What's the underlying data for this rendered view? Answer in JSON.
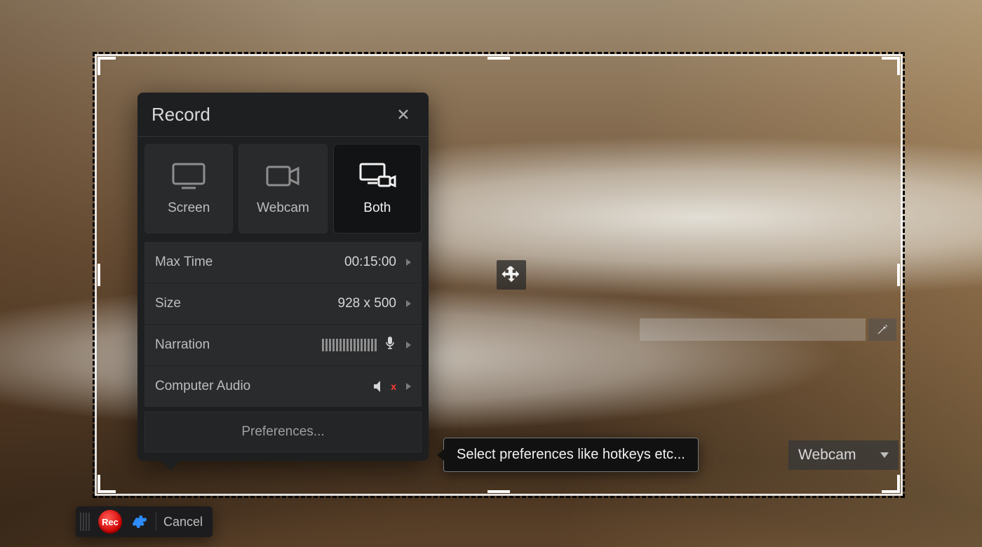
{
  "panel": {
    "title": "Record",
    "modes": {
      "screen": "Screen",
      "webcam": "Webcam",
      "both": "Both"
    },
    "rows": {
      "maxtime_label": "Max Time",
      "maxtime_value": "00:15:00",
      "size_label": "Size",
      "size_value": "928 x 500",
      "narration_label": "Narration",
      "audio_label": "Computer Audio"
    },
    "preferences_label": "Preferences..."
  },
  "tooltip": "Select preferences like hotkeys etc...",
  "webcam_dropdown": "Webcam",
  "controlbar": {
    "rec": "Rec",
    "cancel": "Cancel"
  }
}
